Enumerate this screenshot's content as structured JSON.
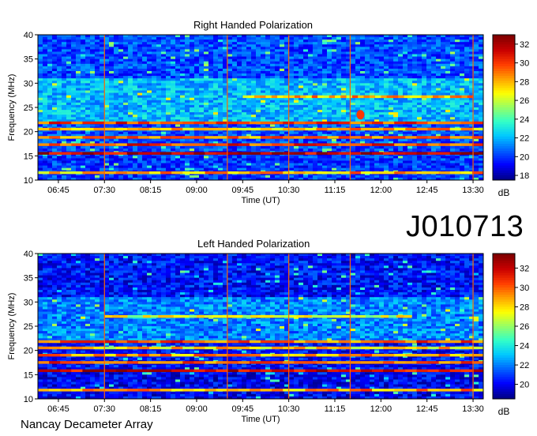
{
  "colors": {
    "colormap": [
      "#00008c",
      "#0000ff",
      "#0064ff",
      "#00c8ff",
      "#32ffc8",
      "#96ff64",
      "#ffff00",
      "#ffa000",
      "#ff3c00",
      "#c80000",
      "#800000"
    ],
    "cursor_lines": "#ff6400"
  },
  "observation_id": "J010713",
  "footer": "Nancay Decameter Array",
  "chart_data": [
    {
      "type": "heatmap",
      "title": "Right Handed Polarization",
      "xlabel": "Time (UT)",
      "ylabel": "Frequency (MHz)",
      "x_ticks": [
        "06:45",
        "07:30",
        "08:15",
        "09:00",
        "09:45",
        "10:30",
        "11:15",
        "12:00",
        "12:45",
        "13:30"
      ],
      "y_ticks": [
        10,
        15,
        20,
        25,
        30,
        35,
        40
      ],
      "ylim": [
        10,
        40
      ],
      "colorbar": {
        "label": "dB",
        "ticks": [
          18,
          20,
          22,
          24,
          26,
          28,
          30,
          32
        ],
        "range": [
          17.5,
          33
        ]
      },
      "vertical_markers": [
        "07:30",
        "09:30",
        "10:30",
        "11:30",
        "13:30"
      ],
      "bright_bands_mhz": [
        11.5,
        15.5,
        17.3,
        18.8,
        20.5,
        21.8,
        27.2
      ],
      "features": [
        {
          "type": "band",
          "freq_mhz": 11.5,
          "level_db": 28
        },
        {
          "type": "band",
          "freq_mhz": 15.5,
          "level_db": 32
        },
        {
          "type": "band",
          "freq_mhz": 17.3,
          "level_db": 30
        },
        {
          "type": "band",
          "freq_mhz": 18.8,
          "level_db": 29
        },
        {
          "type": "band",
          "freq_mhz": 20.5,
          "level_db": 28
        },
        {
          "type": "band",
          "freq_mhz": 21.8,
          "level_db": 30
        },
        {
          "type": "band",
          "freq_mhz": 27.2,
          "level_db": 28,
          "time_from": "09:45",
          "time_to": "13:30"
        },
        {
          "type": "blob",
          "time": "11:40",
          "freq_mhz": 23.5,
          "level_db": 30
        }
      ]
    },
    {
      "type": "heatmap",
      "title": "Left Handed Polarization",
      "xlabel": "Time (UT)",
      "ylabel": "Frequency (MHz)",
      "x_ticks": [
        "06:45",
        "07:30",
        "08:15",
        "09:00",
        "09:45",
        "10:30",
        "11:15",
        "12:00",
        "12:45",
        "13:30"
      ],
      "y_ticks": [
        10,
        15,
        20,
        25,
        30,
        35,
        40
      ],
      "ylim": [
        10,
        40
      ],
      "colorbar": {
        "label": "dB",
        "ticks": [
          20,
          22,
          24,
          26,
          28,
          30,
          32
        ],
        "range": [
          18.5,
          33.5
        ]
      },
      "vertical_markers": [
        "07:30",
        "09:30",
        "10:30",
        "11:30",
        "13:30"
      ],
      "bright_bands_mhz": [
        11.8,
        15.8,
        17.5,
        19.0,
        20.5,
        21.8,
        27.0
      ],
      "features": [
        {
          "type": "band",
          "freq_mhz": 11.8,
          "level_db": 29
        },
        {
          "type": "band",
          "freq_mhz": 15.8,
          "level_db": 32
        },
        {
          "type": "band",
          "freq_mhz": 17.5,
          "level_db": 30
        },
        {
          "type": "band",
          "freq_mhz": 19.0,
          "level_db": 29
        },
        {
          "type": "band",
          "freq_mhz": 20.5,
          "level_db": 28
        },
        {
          "type": "band",
          "freq_mhz": 21.8,
          "level_db": 30
        },
        {
          "type": "band",
          "freq_mhz": 27.0,
          "level_db": 31,
          "time_from": "09:00",
          "time_to": "10:15"
        },
        {
          "type": "band",
          "freq_mhz": 27.0,
          "level_db": 27,
          "time_from": "07:30",
          "time_to": "12:30"
        }
      ]
    }
  ]
}
